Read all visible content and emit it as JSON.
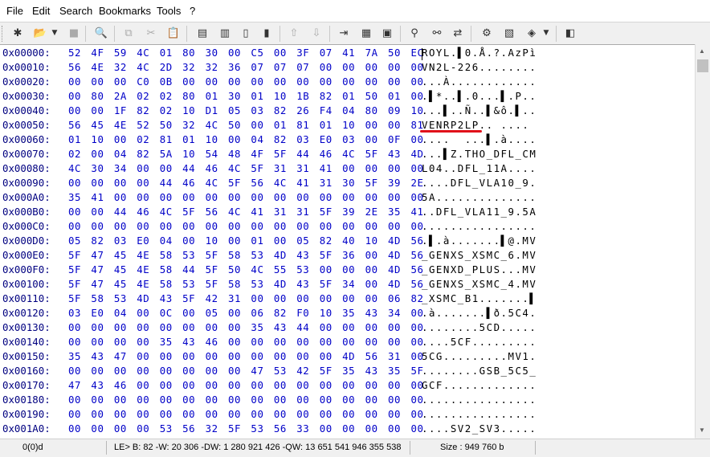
{
  "menu": {
    "file": "File",
    "edit": "Edit",
    "search": "Search",
    "bookmarks": "Bookmarks",
    "tools": "Tools",
    "help": "?"
  },
  "toolbar": {
    "icons": [
      "new-icon",
      "open-icon",
      "open-dropdown-icon",
      "save-icon",
      "print-preview-icon",
      "copy-icon",
      "cut-icon",
      "paste-icon",
      "compare-icon",
      "compare-next-icon",
      "insert-icon",
      "overwrite-icon",
      "undo-icon",
      "redo-icon",
      "goto-icon",
      "bookmark-icon",
      "bookmark-list-icon",
      "find-icon",
      "find-next-icon",
      "replace-icon",
      "checksum-icon",
      "structure-icon",
      "tools-icon",
      "tools-dropdown-icon",
      "options-icon"
    ]
  },
  "hex_rows": [
    {
      "addr": "0x00000:",
      "hex": "52 4F 59 4C 01 80 30 00 C5 00 3F 07 41 7A 50 EC",
      "ascii": "ROYL.▌0.Å.?.AzPì"
    },
    {
      "addr": "0x00010:",
      "hex": "56 4E 32 4C 2D 32 32 36 07 07 07 00 00 00 00 00",
      "ascii": "VN2L-226........"
    },
    {
      "addr": "0x00020:",
      "hex": "00 00 00 C0 0B 00 00 00 00 00 00 00 00 00 00 00",
      "ascii": "...À............"
    },
    {
      "addr": "0x00030:",
      "hex": "00 80 2A 02 02 80 01 30 01 10 1B 82 01 50 01 00",
      "ascii": ".▌*..▌.0...▌.P.."
    },
    {
      "addr": "0x00040:",
      "hex": "00 00 1F 82 02 10 D1 05 03 82 26 F4 04 80 09 10",
      "ascii": "...▌..Ñ..▌&ô.▌.."
    },
    {
      "addr": "0x00050:",
      "hex": "56 45 4E 52 50 32 4C 50 00 01 81 01 10 00 00 81",
      "ascii": "VENRP2LP.. ....  "
    },
    {
      "addr": "0x00060:",
      "hex": "01 10 00 02 81 01 10 00 04 82 03 E0 03 00 0F 00",
      "ascii": "....  ...▌.à...."
    },
    {
      "addr": "0x00070:",
      "hex": "02 00 04 82 5A 10 54 48 4F 5F 44 46 4C 5F 43 4D",
      "ascii": "...▌Z.THO_DFL_CM"
    },
    {
      "addr": "0x00080:",
      "hex": "4C 30 34 00 00 44 46 4C 5F 31 31 41 00 00 00 00",
      "ascii": "L04..DFL_11A...."
    },
    {
      "addr": "0x00090:",
      "hex": "00 00 00 00 44 46 4C 5F 56 4C 41 31 30 5F 39 2E",
      "ascii": "....DFL_VLA10_9."
    },
    {
      "addr": "0x000A0:",
      "hex": "35 41 00 00 00 00 00 00 00 00 00 00 00 00 00 00",
      "ascii": "5A.............."
    },
    {
      "addr": "0x000B0:",
      "hex": "00 00 44 46 4C 5F 56 4C 41 31 31 5F 39 2E 35 41",
      "ascii": "..DFL_VLA11_9.5A"
    },
    {
      "addr": "0x000C0:",
      "hex": "00 00 00 00 00 00 00 00 00 00 00 00 00 00 00 00",
      "ascii": "................"
    },
    {
      "addr": "0x000D0:",
      "hex": "05 82 03 E0 04 00 10 00 01 00 05 82 40 10 4D 56",
      "ascii": ".▌.à.......▌@.MV"
    },
    {
      "addr": "0x000E0:",
      "hex": "5F 47 45 4E 58 53 5F 58 53 4D 43 5F 36 00 4D 56",
      "ascii": "_GENXS_XSMC_6.MV"
    },
    {
      "addr": "0x000F0:",
      "hex": "5F 47 45 4E 58 44 5F 50 4C 55 53 00 00 00 4D 56",
      "ascii": "_GENXD_PLUS...MV"
    },
    {
      "addr": "0x00100:",
      "hex": "5F 47 45 4E 58 53 5F 58 53 4D 43 5F 34 00 4D 56",
      "ascii": "_GENXS_XSMC_4.MV"
    },
    {
      "addr": "0x00110:",
      "hex": "5F 58 53 4D 43 5F 42 31 00 00 00 00 00 00 06 82",
      "ascii": "_XSMC_B1.......▌"
    },
    {
      "addr": "0x00120:",
      "hex": "03 E0 04 00 0C 00 05 00 06 82 F0 10 35 43 34 00",
      "ascii": ".à.......▌ð.5C4."
    },
    {
      "addr": "0x00130:",
      "hex": "00 00 00 00 00 00 00 00 35 43 44 00 00 00 00 00",
      "ascii": "........5CD....."
    },
    {
      "addr": "0x00140:",
      "hex": "00 00 00 00 35 43 46 00 00 00 00 00 00 00 00 00",
      "ascii": "....5CF........."
    },
    {
      "addr": "0x00150:",
      "hex": "35 43 47 00 00 00 00 00 00 00 00 00 4D 56 31 00",
      "ascii": "5CG.........MV1."
    },
    {
      "addr": "0x00160:",
      "hex": "00 00 00 00 00 00 00 00 47 53 42 5F 35 43 35 5F",
      "ascii": "........GSB_5C5_"
    },
    {
      "addr": "0x00170:",
      "hex": "47 43 46 00 00 00 00 00 00 00 00 00 00 00 00 00",
      "ascii": "GCF............."
    },
    {
      "addr": "0x00180:",
      "hex": "00 00 00 00 00 00 00 00 00 00 00 00 00 00 00 00",
      "ascii": "................"
    },
    {
      "addr": "0x00190:",
      "hex": "00 00 00 00 00 00 00 00 00 00 00 00 00 00 00 00",
      "ascii": "................"
    },
    {
      "addr": "0x001A0:",
      "hex": "00 00 00 00 53 56 32 5F 53 56 33 00 00 00 00 00",
      "ascii": "....SV2_SV3....."
    }
  ],
  "status": {
    "offset": "0(0)d",
    "values": "LE> B: 82 -W: 20 306 -DW: 1 280 921 426 -QW: 13 651 541 946 355 538",
    "size": "Size : 949 760 b"
  },
  "colors": {
    "address": "#000080",
    "hex": "#0000c8",
    "highlight_underline": "#e0101a"
  }
}
